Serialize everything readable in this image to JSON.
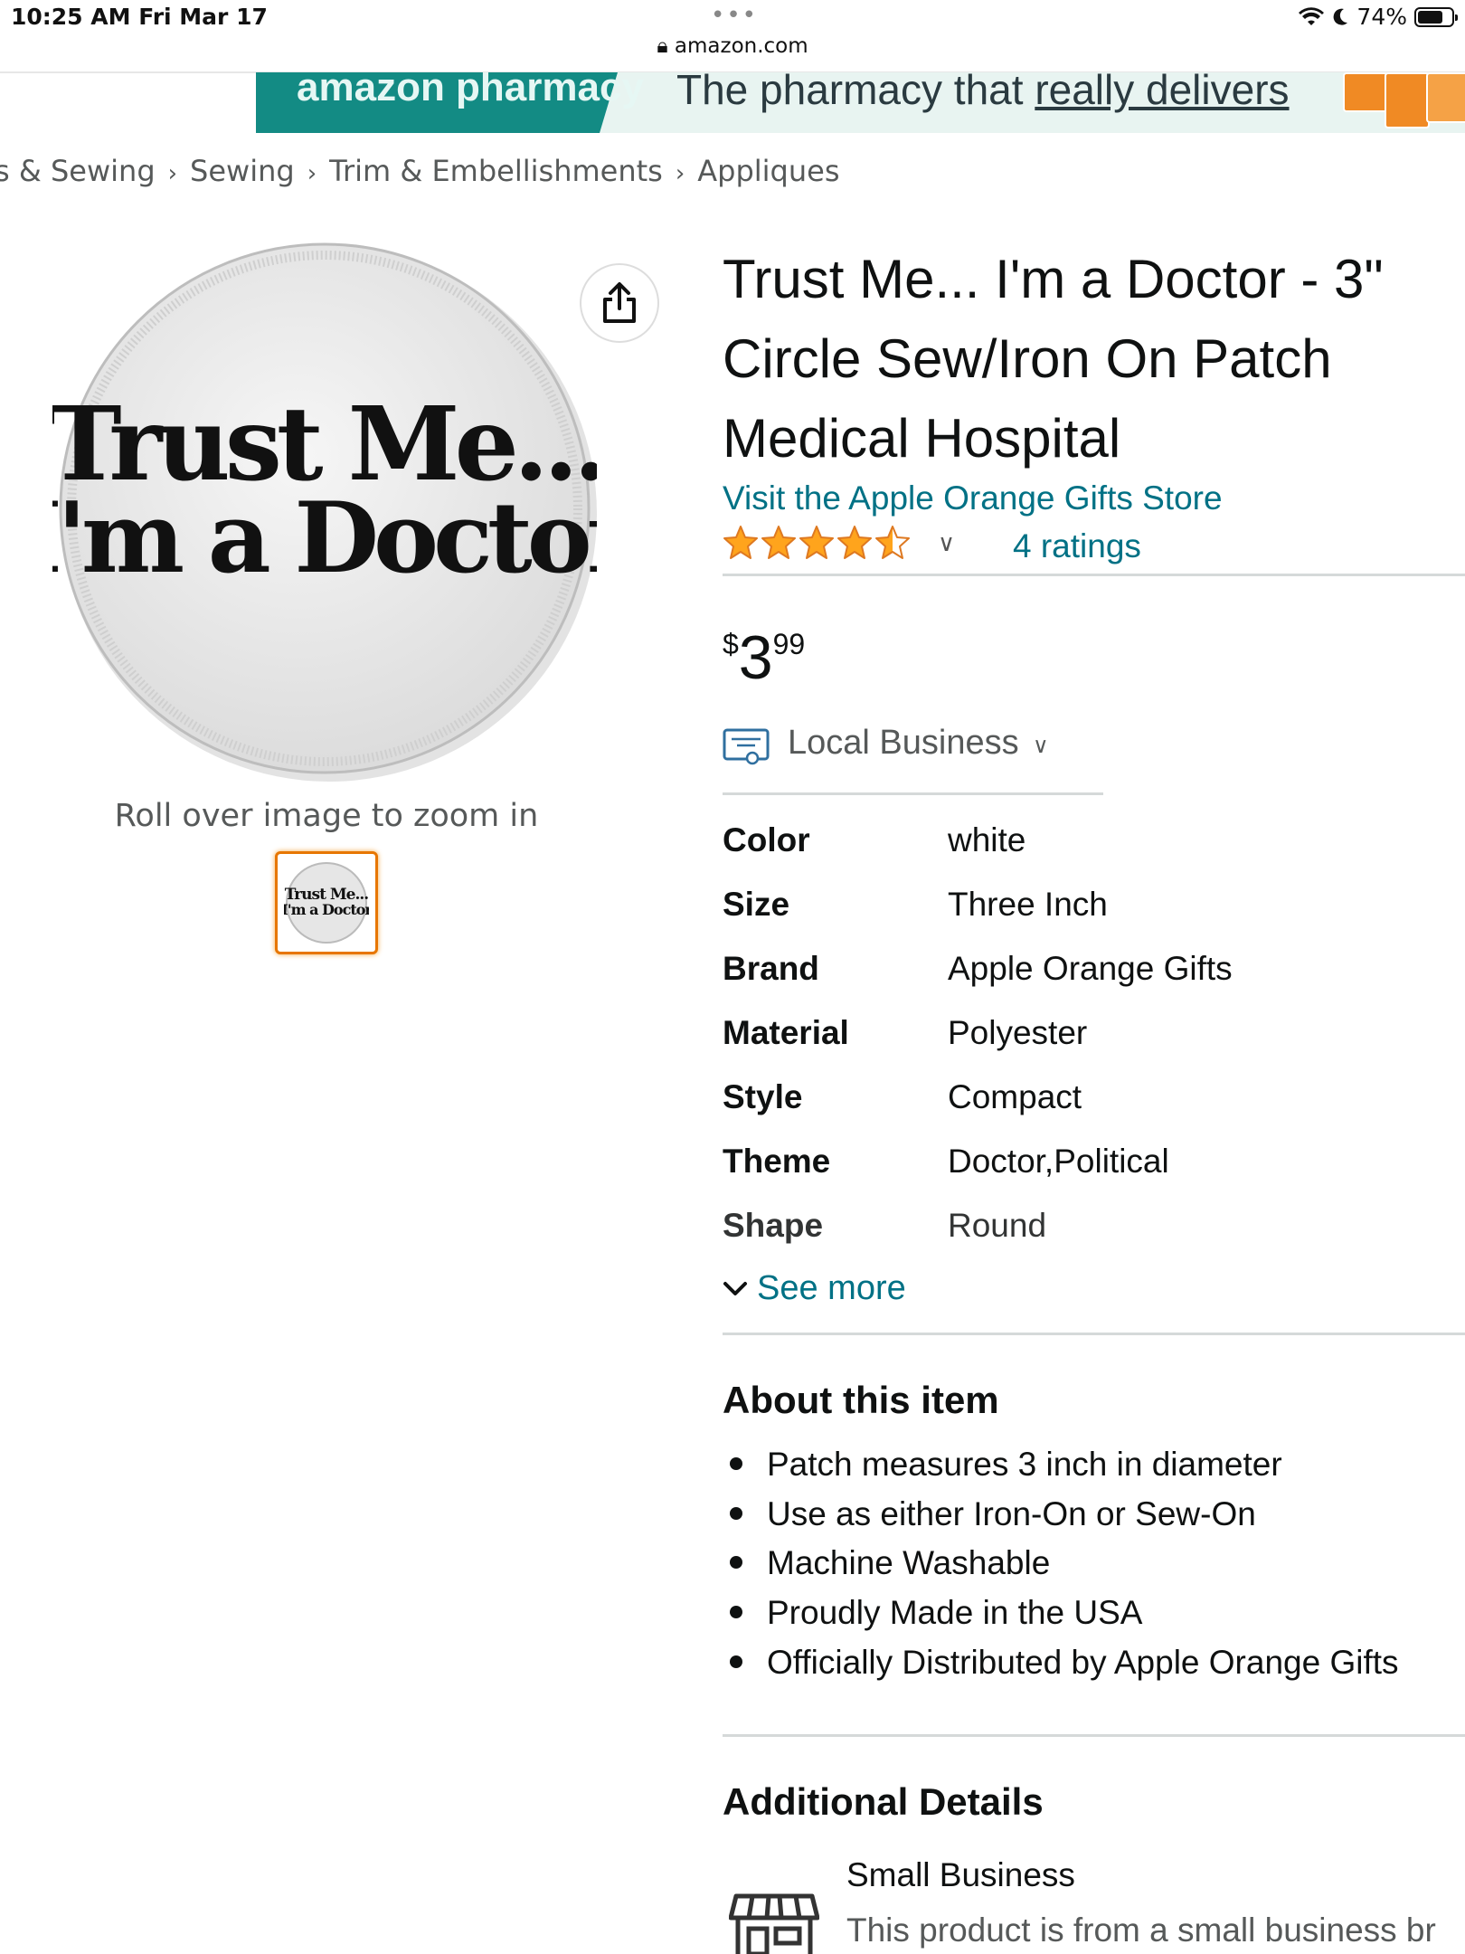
{
  "status_bar": {
    "time": "10:25 AM   Fri Mar 17",
    "dots": "•••",
    "battery": "74%",
    "battery_level": 0.74
  },
  "browser": {
    "url": "amazon.com"
  },
  "banner": {
    "brand": "amazon pharmacy",
    "tagline_prefix": "The pharmacy that ",
    "tagline_emphasis": "really delivers"
  },
  "breadcrumb": [
    "s & Sewing",
    "Sewing",
    "Trim & Embellishments",
    "Appliques"
  ],
  "product": {
    "image_text_line1": "Trust Me...",
    "image_text_line2": "I'm a Doctor",
    "zoom_hint": "Roll over image to zoom in",
    "title": "Trust Me... I'm a Doctor - 3\" Circle Sew/Iron On Patch Medical Hospital",
    "store_link": "Visit the Apple Orange Gifts Store",
    "rating": 4.5,
    "ratings_count": "4 ratings",
    "price": {
      "symbol": "$",
      "whole": "3",
      "fraction": "99"
    },
    "badge": "Local Business",
    "specs": [
      {
        "key": "Color",
        "value": "white"
      },
      {
        "key": "Size",
        "value": "Three Inch"
      },
      {
        "key": "Brand",
        "value": "Apple Orange Gifts"
      },
      {
        "key": "Material",
        "value": "Polyester"
      },
      {
        "key": "Style",
        "value": "Compact"
      },
      {
        "key": "Theme",
        "value": "Doctor,Political"
      },
      {
        "key": "Shape",
        "value": "Round"
      }
    ],
    "see_more": "See more"
  },
  "about": {
    "heading": "About this item",
    "bullets": [
      "Patch measures 3 inch in diameter",
      "Use as either Iron-On or Sew-On",
      "Machine Washable",
      "Proudly Made in the USA",
      "Officially Distributed by Apple Orange Gifts"
    ]
  },
  "additional": {
    "heading": "Additional Details",
    "small_business_title": "Small Business",
    "small_business_desc": "This product is from a small business br"
  },
  "colors": {
    "link": "#007185",
    "star": "#ffa41c",
    "banner_teal": "#138b84",
    "thumb_border": "#e77600"
  }
}
